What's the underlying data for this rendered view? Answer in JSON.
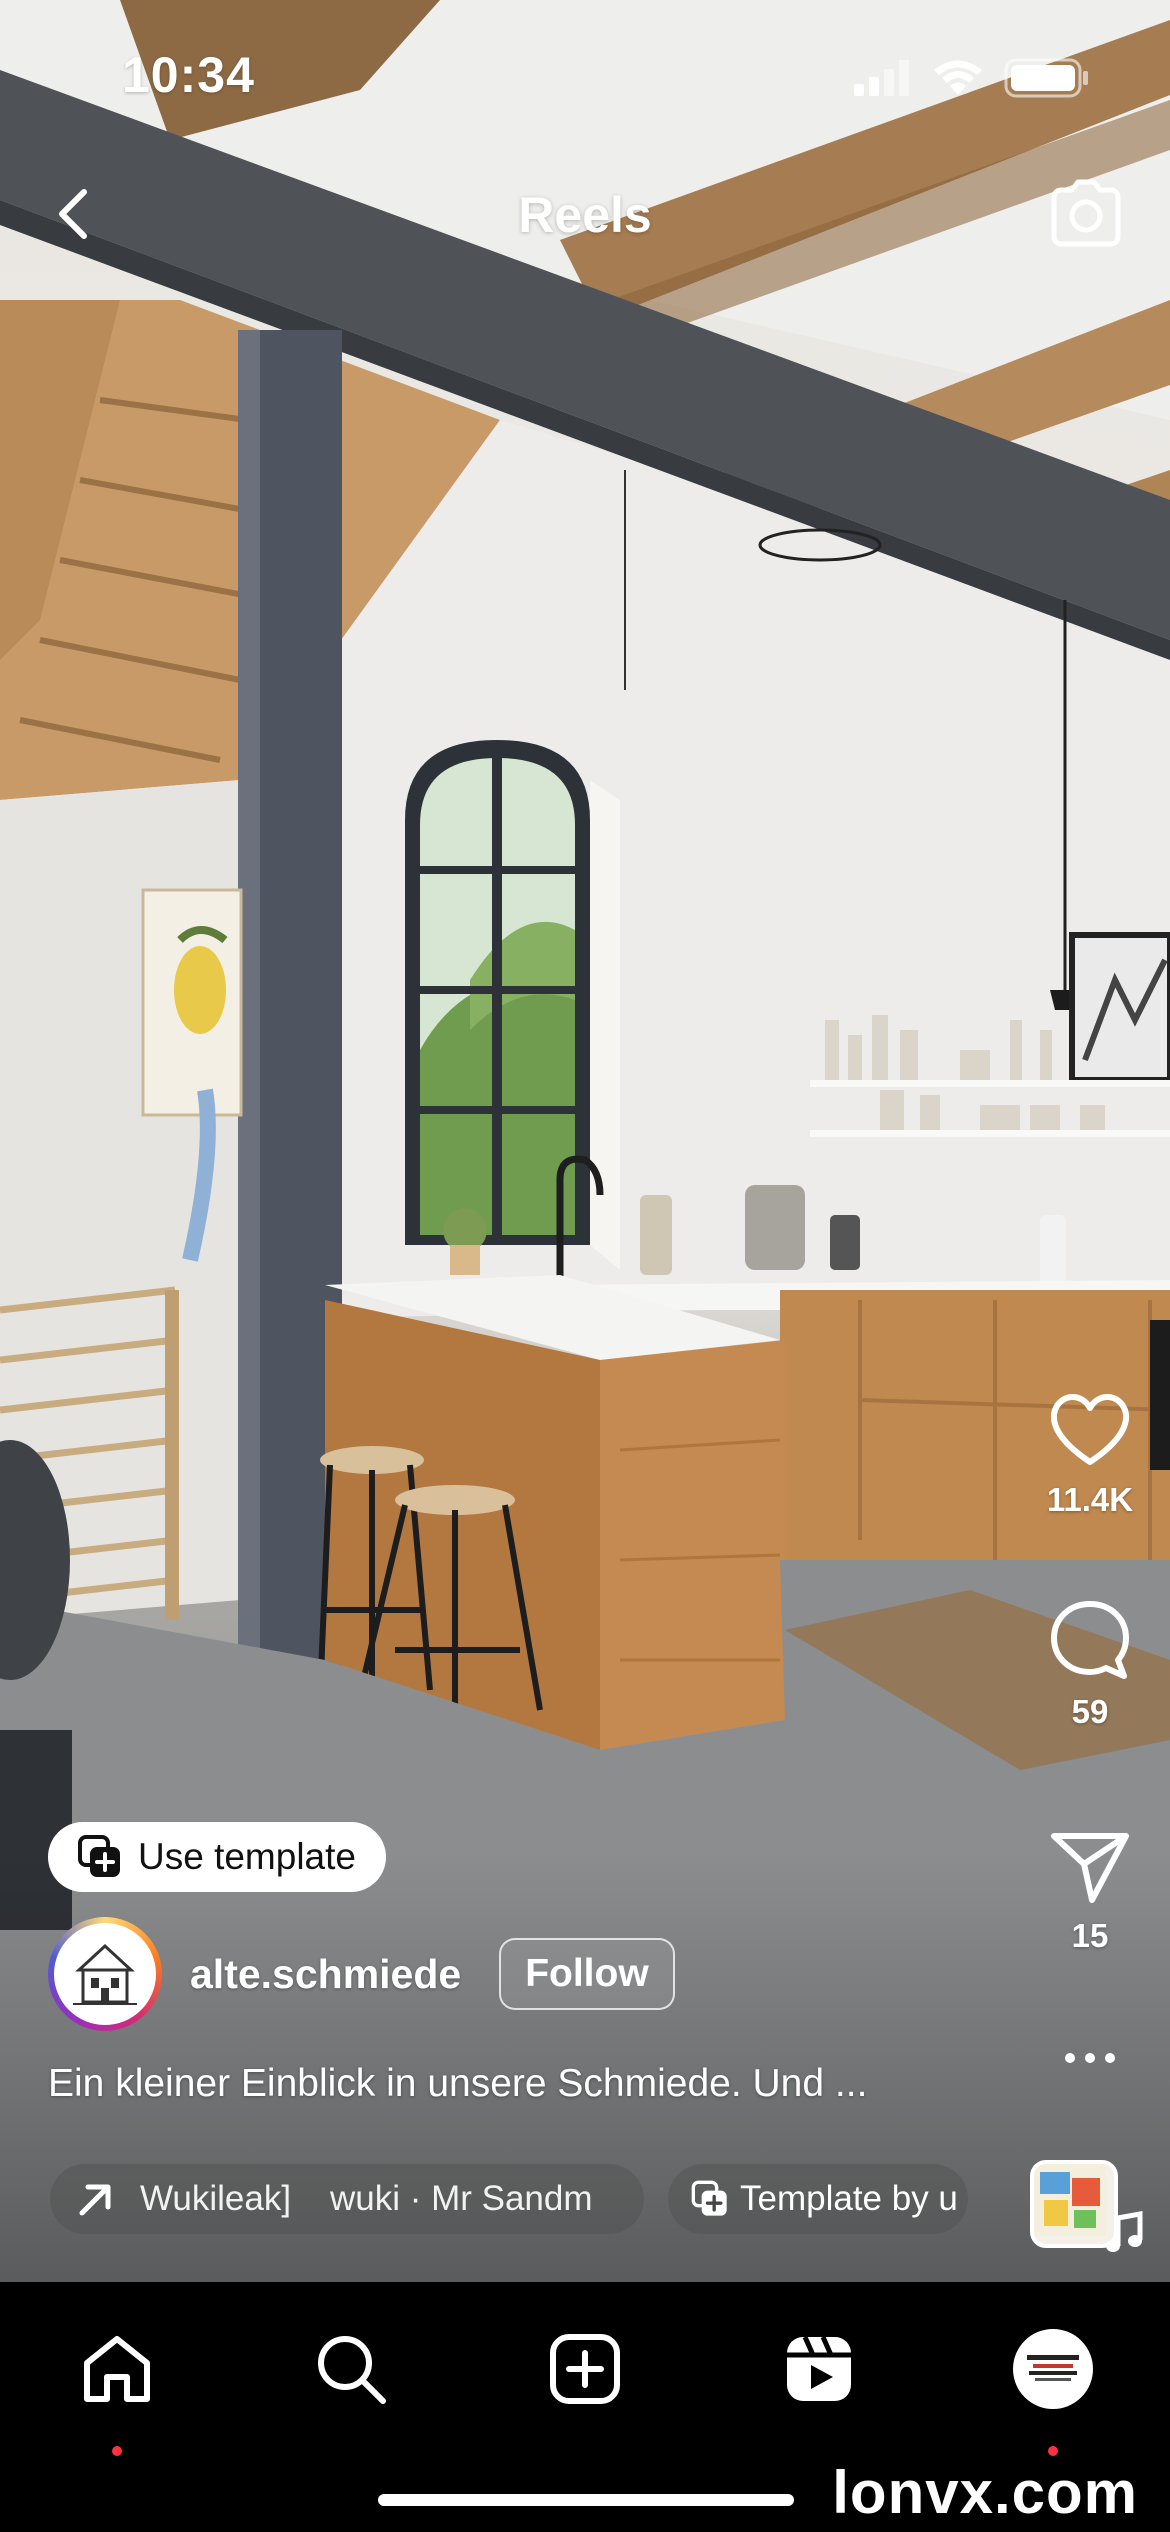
{
  "status_bar": {
    "time": "10:34"
  },
  "header": {
    "title": "Reels"
  },
  "actions": {
    "likes": "11.4K",
    "comments": "59",
    "shares": "15"
  },
  "use_template": {
    "label": "Use template"
  },
  "author": {
    "username": "alte.schmiede",
    "follow_label": "Follow"
  },
  "caption": "Ein kleiner Einblick in unsere Schmiede. Und ...",
  "audio_pill": {
    "text": "Wukileak]    wuki · Mr Sandm"
  },
  "template_pill": {
    "text": "Template by u"
  },
  "colors": {
    "notification_dot": "#ff3040",
    "tab_bar": "#000000",
    "follow_border": "#ffffff"
  },
  "tabs": [
    "home-icon",
    "search-icon",
    "create-icon",
    "reels-icon",
    "profile-avatar"
  ],
  "watermark": "lonvx.com"
}
